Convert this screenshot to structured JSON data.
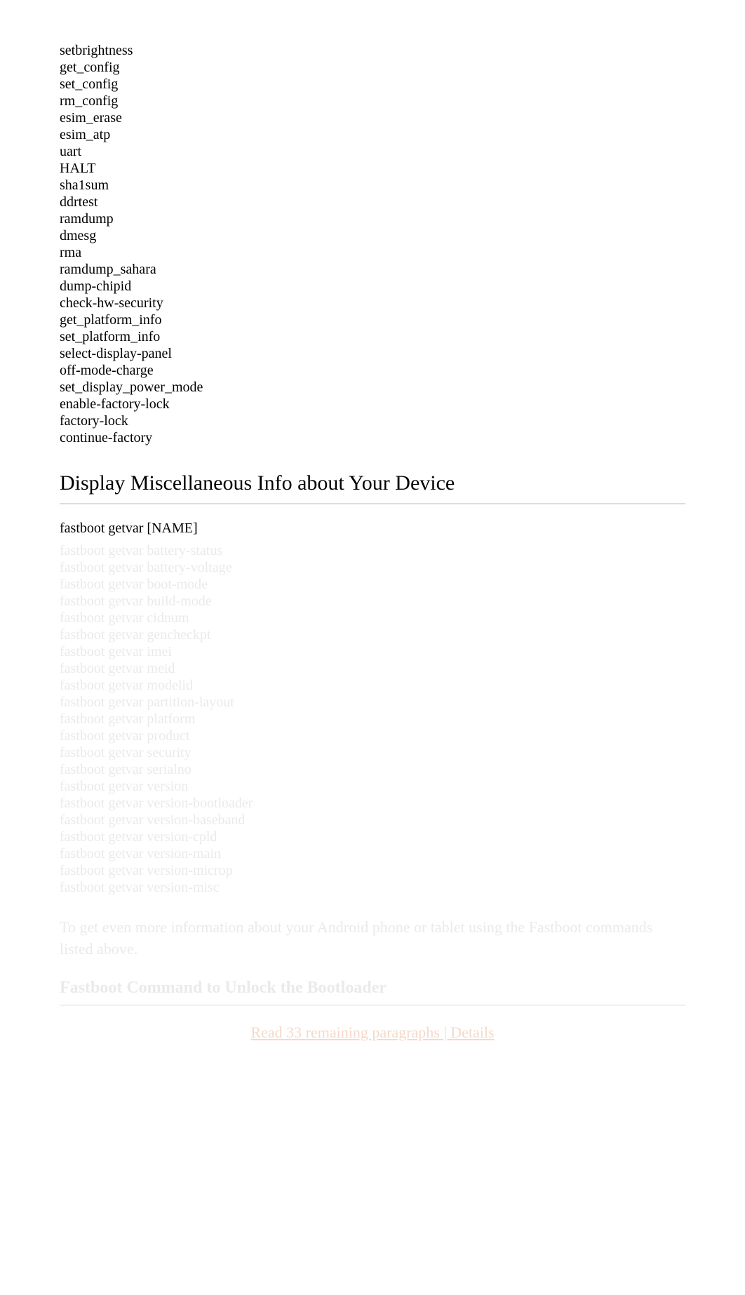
{
  "commands": [
    "setbrightness",
    "get_config",
    "set_config",
    "rm_config",
    "esim_erase",
    "esim_atp",
    "uart",
    "HALT",
    "sha1sum",
    "ddrtest",
    "ramdump",
    "dmesg",
    "rma",
    "ramdump_sahara",
    "dump-chipid",
    "check-hw-security",
    "get_platform_info",
    "set_platform_info",
    "select-display-panel",
    "off-mode-charge",
    "set_display_power_mode",
    "enable-factory-lock",
    "factory-lock",
    "continue-factory"
  ],
  "section1_title": "Display Miscellaneous Info about Your Device",
  "code_header": "fastboot getvar [NAME]",
  "getvar_commands": [
    "fastboot getvar battery-status",
    "fastboot getvar battery-voltage",
    "fastboot getvar boot-mode",
    "fastboot getvar build-mode",
    "fastboot getvar cidnum",
    "fastboot getvar gencheckpt",
    "fastboot getvar imei",
    "fastboot getvar meid",
    "fastboot getvar modelid",
    "fastboot getvar partition-layout",
    "fastboot getvar platform",
    "fastboot getvar product",
    "fastboot getvar security",
    "fastboot getvar serialno",
    "fastboot getvar version",
    "fastboot getvar version-bootloader",
    "fastboot getvar version-baseband",
    "fastboot getvar version-cpld",
    "fastboot getvar version-main",
    "fastboot getvar version-microp",
    "fastboot getvar version-misc"
  ],
  "faded_paragraph": "To get even more information about your Android phone or tablet using the Fastboot commands listed above.",
  "section2_title": "Fastboot Command to Unlock the Bootloader",
  "link_text": "Read 33 remaining paragraphs   |   Details"
}
